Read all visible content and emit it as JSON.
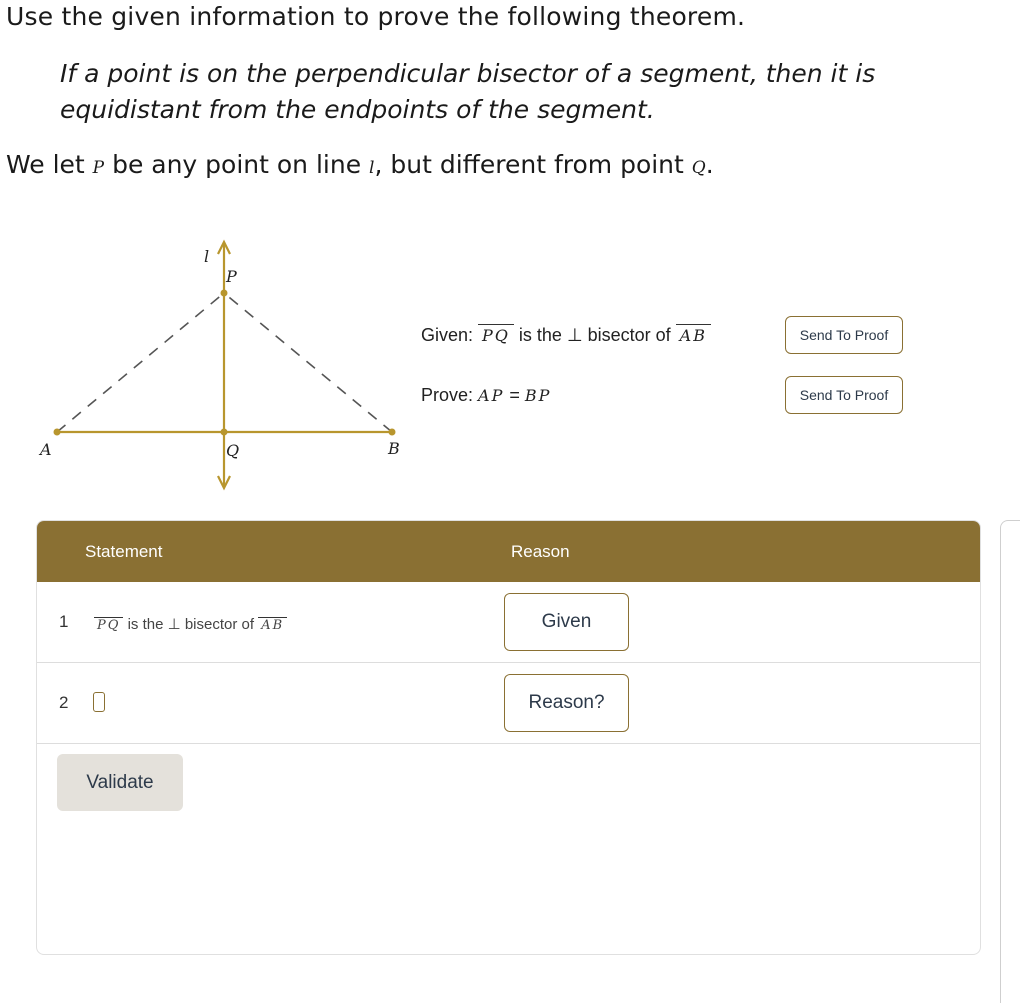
{
  "header": {
    "instruction": "Use the given information to prove the following theorem.",
    "theorem_line1": "If a point is on the perpendicular bisector of a segment, then it is",
    "theorem_line2": "equidistant from the endpoints of the segment.",
    "let_prefix": "We let ",
    "let_var_p": "P",
    "let_mid1": " be any point on line ",
    "let_var_l": "l",
    "let_mid2": ", but different from point ",
    "let_var_q": "Q",
    "let_suffix": "."
  },
  "diagram": {
    "label_l": "l",
    "label_p": "P",
    "label_a": "A",
    "label_q": "Q",
    "label_b": "B",
    "line_color": "#b8962e",
    "dash_color": "#555555"
  },
  "given": {
    "prefix": "Given: ",
    "seg1": "PQ",
    "middle": " is the ⊥ bisector of ",
    "seg2": "AB",
    "button": "Send To Proof"
  },
  "prove": {
    "prefix": "Prove: ",
    "left": "AP",
    "equals": " = ",
    "right": "BP",
    "button": "Send To Proof"
  },
  "proof_table": {
    "header_statement": "Statement",
    "header_reason": "Reason",
    "rows": [
      {
        "num": "1",
        "seg1": "PQ",
        "middle": " is the ⊥ bisector of ",
        "seg2": "AB",
        "reason": "Given"
      },
      {
        "num": "2",
        "reason": "Reason?"
      }
    ],
    "validate": "Validate"
  },
  "colors": {
    "accent": "#8a7033",
    "header_bg": "#8a7033",
    "button_text": "#2d3a4a",
    "validate_bg": "#e4e1db"
  }
}
